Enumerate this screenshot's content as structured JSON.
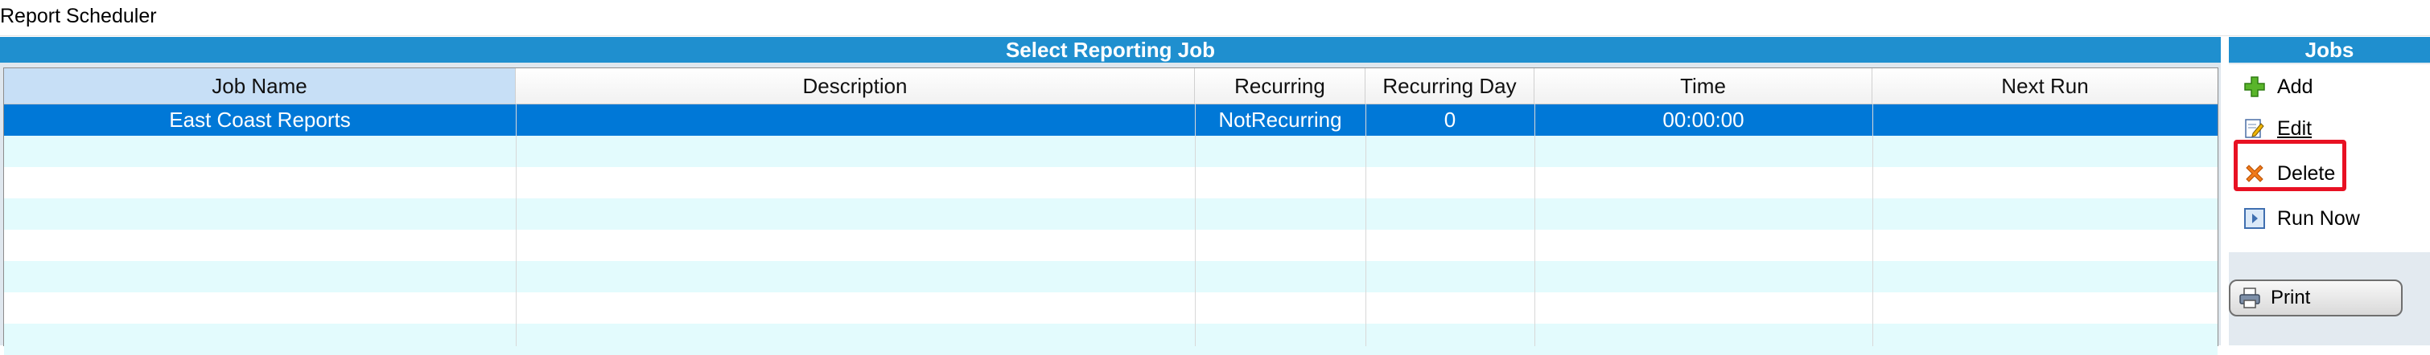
{
  "window": {
    "title": "Report Scheduler"
  },
  "main": {
    "header": "Select Reporting Job",
    "columns": [
      "Job Name",
      "Description",
      "Recurring",
      "Recurring Day",
      "Time",
      "Next Run"
    ],
    "rows": [
      {
        "job_name": "East Coast Reports",
        "description": "",
        "recurring": "NotRecurring",
        "recurring_day": "0",
        "time": "00:00:00",
        "next_run": ""
      }
    ],
    "selected_row": 0
  },
  "jobs_panel": {
    "header": "Jobs",
    "actions": [
      {
        "label": "Add",
        "icon": "add-icon"
      },
      {
        "label": "Edit",
        "icon": "edit-icon"
      },
      {
        "label": "Delete",
        "icon": "delete-icon"
      },
      {
        "label": "Run Now",
        "icon": "run-now-icon"
      }
    ],
    "print_label": "Print"
  },
  "colors": {
    "header_blue": "#1f8fcf",
    "selection_blue": "#0078d7",
    "alt_row": "#e3fbfd",
    "highlight_red": "#e81123"
  }
}
